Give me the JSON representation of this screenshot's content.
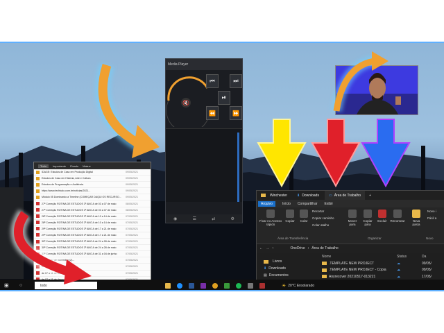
{
  "player": {
    "title": "Media Player",
    "footer_icons": [
      "speaker-icon",
      "list-icon",
      "shuffle-icon",
      "settings-icon"
    ]
  },
  "filelist": {
    "tabs": [
      "Tudo",
      "Importante",
      "Fixado",
      "Mais ▾"
    ],
    "rows": [
      {
        "text": "IDAGE: Estudos de Caso em Produção Digital",
        "date": "09/05/2021"
      },
      {
        "text": "Estudos de Caso em História, Arte e Cultura",
        "date": "09/05/2021"
      },
      {
        "text": "Estudos de Programação e Audiência",
        "date": "09/05/2021"
      },
      {
        "text": "https://www.techtudo.com.br/noticias/2021...",
        "date": "09/05/2021"
      },
      {
        "text": "Módulo 05 Dominando a Timeline (COMEÇAR DAQUI OS RECURSO...",
        "date": "09/05/2021"
      },
      {
        "text": "27ª Correção   ROTINA DE ESTUDOS 3º ANO A   de 03 a 07 de maio",
        "date": "08/05/2021"
      },
      {
        "text": "27ª Correção   ROTINA DE ESTUDOS 3º ANO A   de 03 a 07 de maio",
        "date": "08/05/2021"
      },
      {
        "text": "28ª Correção   ROTINA DE ESTUDOS 3º ANO A   de 10 a 14 de maio",
        "date": "07/05/2021"
      },
      {
        "text": "28ª Correção   ROTINA DE ESTUDOS 3º ANO A   de 10 a 14 de maio",
        "date": "07/05/2021"
      },
      {
        "text": "29ª Correção   ROTINA DE ESTUDOS 3º ANO A   de 17 a 21 de maio",
        "date": "07/05/2021"
      },
      {
        "text": "29ª Correção   ROTINA DE ESTUDOS 3º ANO A   de 17 a 21 de maio",
        "date": "07/05/2021"
      },
      {
        "text": "30ª Correção   ROTINA DE ESTUDOS 3º ANO A   de 24 a 28 de maio",
        "date": "07/05/2021"
      },
      {
        "text": "30ª Correção   ROTINA DE ESTUDOS 3º ANO A   de 24 a 28 de maio",
        "date": "07/05/2021"
      },
      {
        "text": "31ª Correção   ROTINA DE ESTUDOS 3º ANO A   de 31 a 04 de junho",
        "date": "07/05/2021"
      },
      {
        "text": "de 23 a 27 de novembro (2)...",
        "date": "07/05/2021"
      },
      {
        "text": "de 23 a 27 de novembro.pdf",
        "date": "07/05/2021"
      },
      {
        "text": "de 07 a 11 de dezembro (2)...",
        "date": "07/05/2021"
      },
      {
        "text": "de 07 a 11 de dezembro.pdf",
        "date": "07/05/2021"
      },
      {
        "text": "de 14 a 18 de dezembro (2)...",
        "date": "07/05/2021"
      },
      {
        "text": "de 14 a 18 de dezembro.pdf",
        "date": "07/05/2021"
      }
    ]
  },
  "explorer": {
    "tabs": [
      "Winchester",
      "Downloads",
      "Área de Trabalho"
    ],
    "ribbon_tabs": [
      "Arquivo",
      "Início",
      "Compartilhar",
      "Exibir"
    ],
    "ribbon": {
      "pin": "Fixar no Acesso rápido",
      "copy": "Copiar",
      "paste": "Colar",
      "cut": "Recortar",
      "copy_path": "Copiar caminho",
      "paste_shortcut": "Colar atalho",
      "move_to": "Mover para",
      "copy_to": "Copiar para",
      "delete": "Excluir",
      "rename": "Renomear",
      "new_folder": "Nova pasta",
      "new_item": "Novo i",
      "easy_access": "Fácil a",
      "group_clipboard": "Área de Transferência",
      "group_organize": "Organizar",
      "group_new": "Novo"
    },
    "breadcrumb": [
      "OneDrive",
      "Área de Trabalho"
    ],
    "nav": [
      "Livros",
      "Downloads",
      "Documentos"
    ],
    "columns": {
      "name": "Nome",
      "status": "Status",
      "date": "Da"
    },
    "files": [
      {
        "name": ".TEMPLATE NEW PROJECT",
        "date": "09/05/"
      },
      {
        "name": ".TEMPLATE NEW PROJECT - Copia",
        "date": "09/05/"
      },
      {
        "name": "Anyrecover 20210517-013221",
        "date": "17/05/"
      }
    ]
  },
  "taskbar": {
    "search_placeholder": "todo",
    "weather": "20°C  Ensolarado"
  },
  "colors": {
    "arrow_orange": "#f0a030",
    "arrow_yellow": "#ffe600",
    "arrow_red": "#e0202a",
    "arrow_blue": "#2a6cf0",
    "arrow_curve_red": "#e0202a"
  }
}
